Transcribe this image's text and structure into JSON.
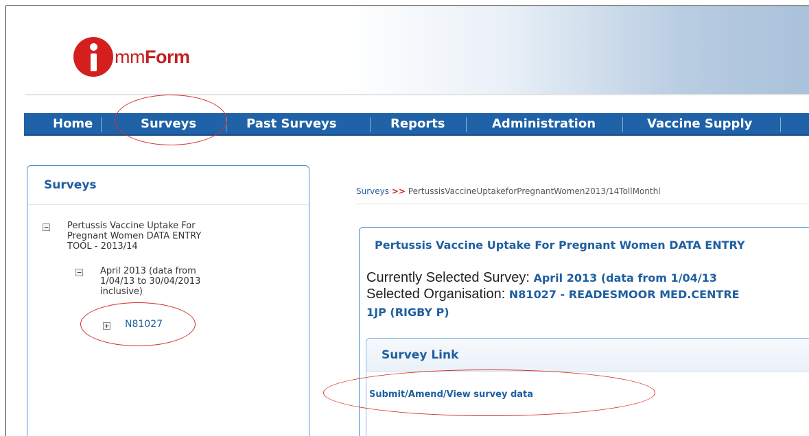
{
  "logo": {
    "prefix": "mm",
    "bold": "Form"
  },
  "nav": [
    {
      "label": "Home"
    },
    {
      "label": "Surveys"
    },
    {
      "label": "Past Surveys"
    },
    {
      "label": "Reports"
    },
    {
      "label": "Administration"
    },
    {
      "label": "Vaccine Supply"
    }
  ],
  "sidebar": {
    "title": "Surveys",
    "tree": {
      "survey_toggle": "−",
      "survey_label": "Pertussis Vaccine Uptake For\nPregnant Women DATA ENTRY\nTOOL - 2013/14",
      "month_toggle": "−",
      "month_label": "April 2013 (data from\n1/04/13 to 30/04/2013\ninclusive)",
      "org_toggle": "+",
      "org_label": "N81027"
    }
  },
  "breadcrumb": {
    "root": "Surveys",
    "separator": ">>",
    "current": "PertussisVaccineUptakeforPregnantWomen2013/14TollMonthl"
  },
  "panel": {
    "title": "Pertussis Vaccine Uptake For Pregnant Women DATA ENTRY",
    "selected_survey_label": "Currently Selected Survey:",
    "selected_survey_value": "April 2013 (data from 1/04/13",
    "selected_org_label": "Selected Organisation:",
    "selected_org_value": "N81027 - READESMOOR MED.CENTRE",
    "selected_org_value_line2": "1JP (RIGBY P)"
  },
  "survey_link": {
    "title": "Survey Link",
    "link_text": "Submit/Amend/View survey data"
  },
  "colors": {
    "nav_bg": "#1f62a8",
    "accent": "#1f5fa0",
    "annotation": "#d3322a",
    "logo_red": "#d51f1f"
  }
}
